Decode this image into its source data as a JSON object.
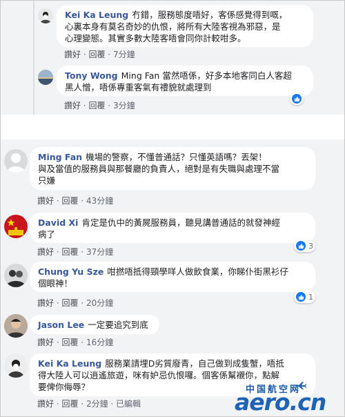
{
  "actions": {
    "like": "讚好",
    "reply": "回覆",
    "edited": "已編輯"
  },
  "comments": [
    {
      "name": "Kei Ka Leung",
      "line1": "冇錯，服務態度唔好，客係感覺得到嘅，",
      "line2": "心裏本身有莫名奇妙的仇恨，將所有大陸客視為邪惡，是",
      "line3": "心理變態。其實多數大陸客唔會同你計較咁多。",
      "time": "7分鐘"
    },
    {
      "name": "Tony Wong",
      "line1": "Ming Fan 當然唔係，好多本地客同白人客超",
      "line2": "黑人憎，唔係專重客氣有禮貌就處理到",
      "time": "3分鐘",
      "reactions": ""
    },
    {
      "name": "Ming Fan",
      "line1": "機場的警察，不懂普通話？只懂英語嗎？丟架！",
      "line2": "與及當值的服務員與那餐廳的負責人，絕對是有失職與處理不當",
      "line3": "只嫌",
      "time": "43分鐘"
    },
    {
      "name": "David Xi",
      "line1": "肯定是仇中的黃屍服務員，聽見講普通話的就發神經",
      "line2": "病了",
      "time": "37分鐘",
      "reactions": "3"
    },
    {
      "name": "Chung Yu Sze",
      "line1": "咁撚唔抵得頸學咩人做飲食業，你睇仆街黑衫仔",
      "line2": "個眼神！",
      "time": "20分鐘",
      "reactions": "1"
    },
    {
      "name": "Jason Lee",
      "line1": "一定要追究到底",
      "time": "16分鐘"
    },
    {
      "name": "Kei Ka Leung",
      "line1": "服務業請埋D劣質廢青，自己做到成隻蟹，唔抵",
      "line2": "得大陸人可以逍遙旅遊，咪有妒忌仇恨囉。個客係幫襯你，點解",
      "line3": "要俾你侮辱？",
      "time": "2分鐘"
    }
  ],
  "watermark": {
    "top": "中国航空网",
    "bottom": "aero.cn"
  }
}
